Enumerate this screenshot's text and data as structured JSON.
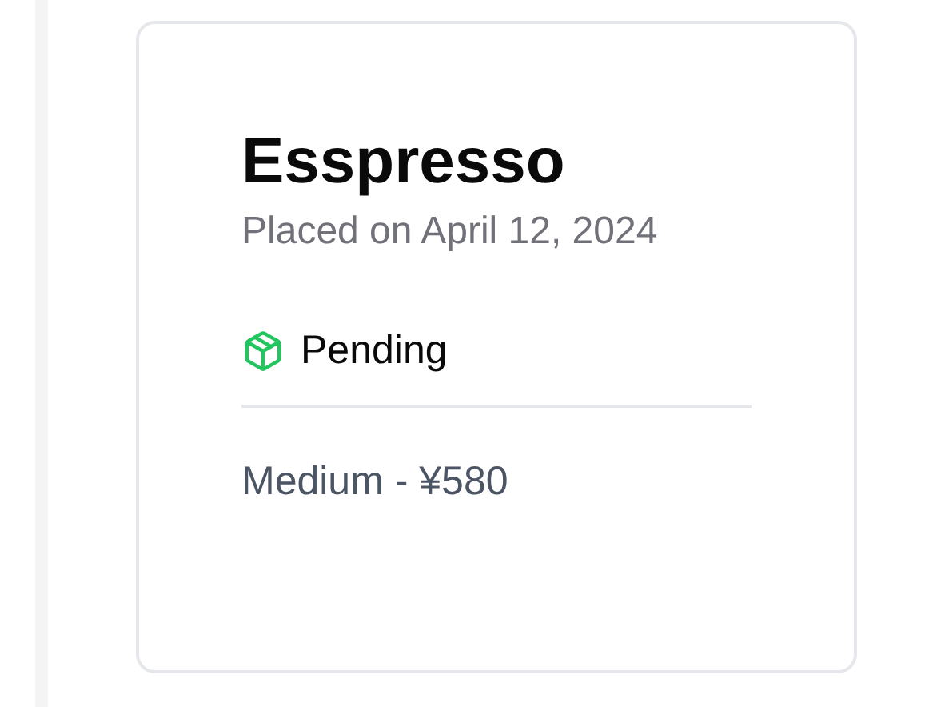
{
  "order": {
    "title": "Esspresso",
    "placed": "Placed on April 12, 2024",
    "status": {
      "label": "Pending",
      "kind": "pending"
    },
    "detail": "Medium - ¥580"
  }
}
